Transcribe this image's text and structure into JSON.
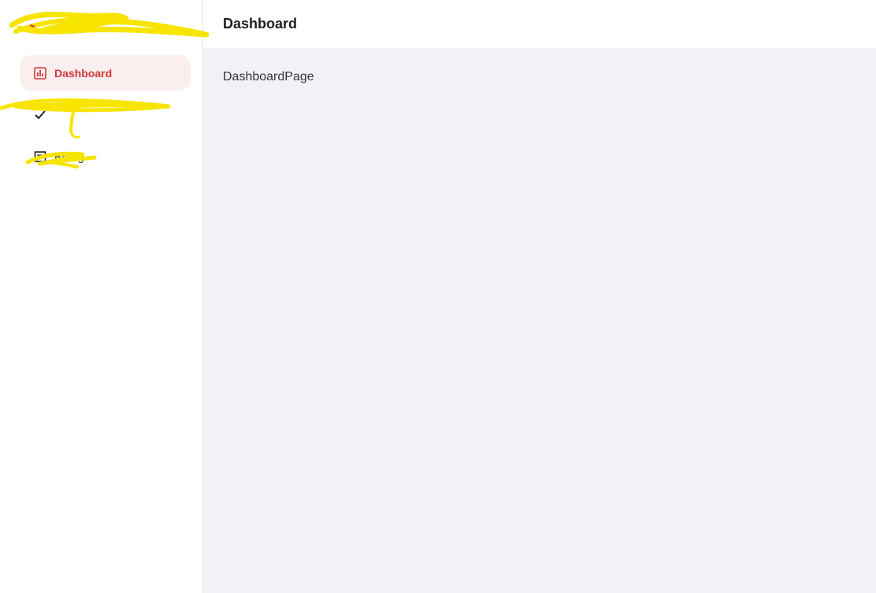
{
  "sidebar": {
    "items": [
      {
        "label": "Dashboard",
        "icon": "bar-chart-icon",
        "active": true
      },
      {
        "label": "",
        "icon": "checkmark-icon",
        "active": false
      },
      {
        "label": "Billing",
        "icon": "receipt-icon",
        "active": false
      }
    ]
  },
  "header": {
    "title": "Dashboard"
  },
  "main": {
    "page_text": "DashboardPage"
  },
  "colors": {
    "accent": "#cf3a3a",
    "active_bg": "#fbeeee",
    "content_bg": "#f0f2f7",
    "redaction": "#f7e400"
  }
}
